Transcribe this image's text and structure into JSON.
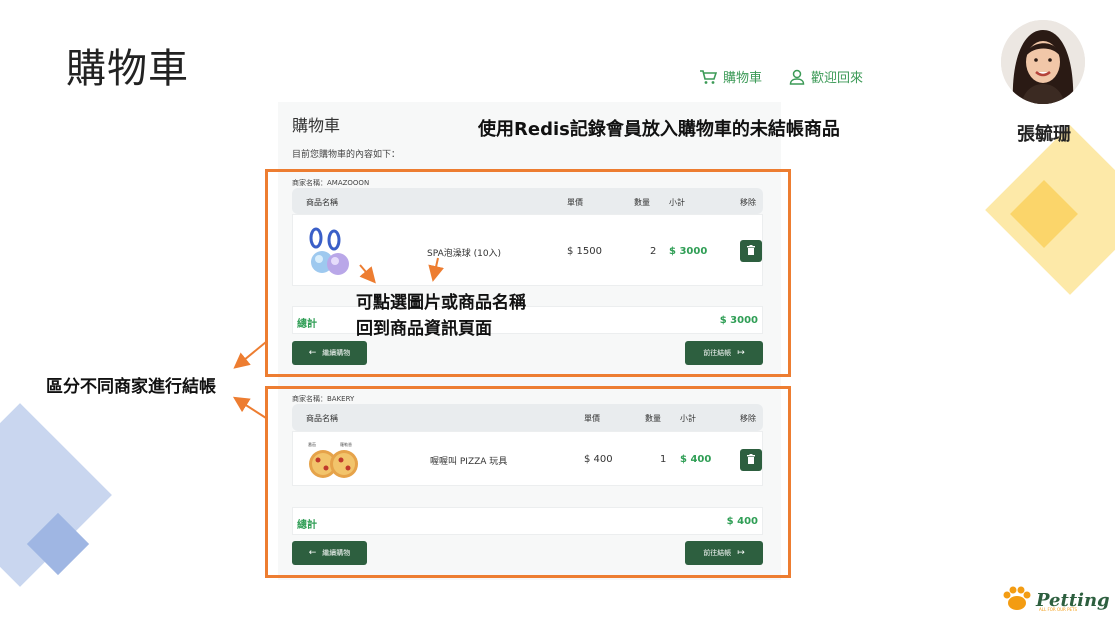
{
  "slide": {
    "title": "購物車",
    "presenter_name": "張毓珊"
  },
  "nav": {
    "cart_label": "購物車",
    "welcome_label": "歡迎回來"
  },
  "cart": {
    "heading": "購物車",
    "subheading": "目前您購物車的內容如下：",
    "columns": {
      "product": "商品名稱",
      "price": "單價",
      "quantity": "數量",
      "subtotal": "小計",
      "remove": "移除"
    },
    "merchants": [
      {
        "label": "商家名稱：AMAZOOON",
        "items": [
          {
            "name": "SPA泡澡球 (10入)",
            "price": "$ 1500",
            "quantity": "2",
            "subtotal": "$ 3000"
          }
        ],
        "total_label": "總計",
        "total_value": "$ 3000",
        "continue_label": "繼續購物",
        "checkout_label": "前往結帳"
      },
      {
        "label": "商家名稱：BAKERY",
        "items": [
          {
            "name": "喔喔叫 PIZZA 玩具",
            "price": "$ 400",
            "quantity": "1",
            "subtotal": "$ 400"
          }
        ],
        "total_label": "總計",
        "total_value": "$ 400",
        "continue_label": "繼續購物",
        "checkout_label": "前往結帳"
      }
    ]
  },
  "annotations": {
    "redis_note": "使用Redis記錄會員放入購物車的未結帳商品",
    "click_note_line1": "可點選圖片或商品名稱",
    "click_note_line2": "回到商品資訊頁面",
    "merchant_note": "區分不同商家進行結帳"
  },
  "pizza_labels": [
    "番茄",
    "羅勒香"
  ],
  "logo": {
    "name": "Petting",
    "tagline": "ALL FOR OUR PETS"
  },
  "colors": {
    "accent_green": "#2f9e55",
    "button_green": "#2d5f3f",
    "highlight_orange": "#ed7d31"
  }
}
